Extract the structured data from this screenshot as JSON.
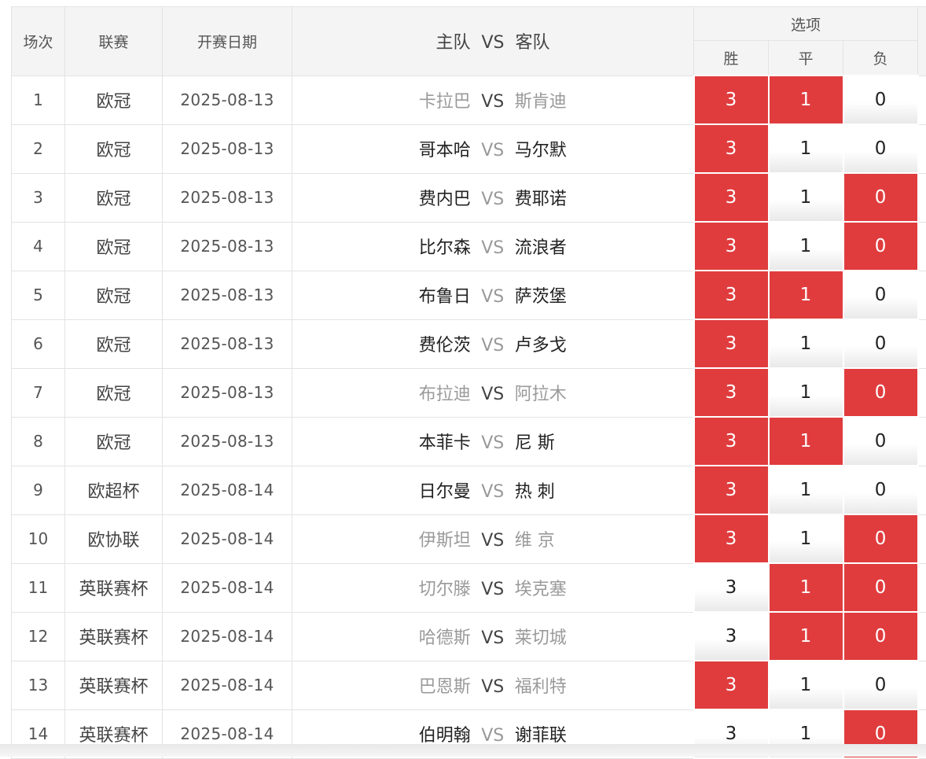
{
  "header": {
    "col_no": "场次",
    "col_league": "联赛",
    "col_date": "开赛日期",
    "col_home": "主队",
    "col_vs": "VS",
    "col_away": "客队",
    "col_options": "选项",
    "opt_win": "胜",
    "opt_draw": "平",
    "opt_lose": "负"
  },
  "colors": {
    "selected": "#e03c3e",
    "header_bg": "#f4f4f4"
  },
  "rows": [
    {
      "no": "1",
      "league": "欧冠",
      "date": "2025-08-13",
      "home": "卡拉巴",
      "vs": "VS",
      "away": "斯肯迪",
      "win": "3",
      "draw": "1",
      "lose": "0",
      "win_sel": true,
      "draw_sel": true,
      "lose_sel": false,
      "dim": true
    },
    {
      "no": "2",
      "league": "欧冠",
      "date": "2025-08-13",
      "home": "哥本哈",
      "vs": "VS",
      "away": "马尔默",
      "win": "3",
      "draw": "1",
      "lose": "0",
      "win_sel": true,
      "draw_sel": false,
      "lose_sel": false,
      "dim": false
    },
    {
      "no": "3",
      "league": "欧冠",
      "date": "2025-08-13",
      "home": "费内巴",
      "vs": "VS",
      "away": "费耶诺",
      "win": "3",
      "draw": "1",
      "lose": "0",
      "win_sel": true,
      "draw_sel": false,
      "lose_sel": true,
      "dim": false
    },
    {
      "no": "4",
      "league": "欧冠",
      "date": "2025-08-13",
      "home": "比尔森",
      "vs": "VS",
      "away": "流浪者",
      "win": "3",
      "draw": "1",
      "lose": "0",
      "win_sel": true,
      "draw_sel": false,
      "lose_sel": true,
      "dim": false
    },
    {
      "no": "5",
      "league": "欧冠",
      "date": "2025-08-13",
      "home": "布鲁日",
      "vs": "VS",
      "away": "萨茨堡",
      "win": "3",
      "draw": "1",
      "lose": "0",
      "win_sel": true,
      "draw_sel": true,
      "lose_sel": false,
      "dim": false
    },
    {
      "no": "6",
      "league": "欧冠",
      "date": "2025-08-13",
      "home": "费伦茨",
      "vs": "VS",
      "away": "卢多戈",
      "win": "3",
      "draw": "1",
      "lose": "0",
      "win_sel": true,
      "draw_sel": false,
      "lose_sel": false,
      "dim": false
    },
    {
      "no": "7",
      "league": "欧冠",
      "date": "2025-08-13",
      "home": "布拉迪",
      "vs": "VS",
      "away": "阿拉木",
      "win": "3",
      "draw": "1",
      "lose": "0",
      "win_sel": true,
      "draw_sel": false,
      "lose_sel": true,
      "dim": true
    },
    {
      "no": "8",
      "league": "欧冠",
      "date": "2025-08-13",
      "home": "本菲卡",
      "vs": "VS",
      "away": "尼 斯",
      "win": "3",
      "draw": "1",
      "lose": "0",
      "win_sel": true,
      "draw_sel": true,
      "lose_sel": false,
      "dim": false
    },
    {
      "no": "9",
      "league": "欧超杯",
      "date": "2025-08-14",
      "home": "日尔曼",
      "vs": "VS",
      "away": "热 刺",
      "win": "3",
      "draw": "1",
      "lose": "0",
      "win_sel": true,
      "draw_sel": false,
      "lose_sel": false,
      "dim": false
    },
    {
      "no": "10",
      "league": "欧协联",
      "date": "2025-08-14",
      "home": "伊斯坦",
      "vs": "VS",
      "away": "维 京",
      "win": "3",
      "draw": "1",
      "lose": "0",
      "win_sel": true,
      "draw_sel": false,
      "lose_sel": true,
      "dim": true
    },
    {
      "no": "11",
      "league": "英联赛杯",
      "date": "2025-08-14",
      "home": "切尔滕",
      "vs": "VS",
      "away": "埃克塞",
      "win": "3",
      "draw": "1",
      "lose": "0",
      "win_sel": false,
      "draw_sel": true,
      "lose_sel": true,
      "dim": true
    },
    {
      "no": "12",
      "league": "英联赛杯",
      "date": "2025-08-14",
      "home": "哈德斯",
      "vs": "VS",
      "away": "莱切城",
      "win": "3",
      "draw": "1",
      "lose": "0",
      "win_sel": false,
      "draw_sel": true,
      "lose_sel": true,
      "dim": true
    },
    {
      "no": "13",
      "league": "英联赛杯",
      "date": "2025-08-14",
      "home": "巴恩斯",
      "vs": "VS",
      "away": "福利特",
      "win": "3",
      "draw": "1",
      "lose": "0",
      "win_sel": true,
      "draw_sel": false,
      "lose_sel": false,
      "dim": true
    },
    {
      "no": "14",
      "league": "英联赛杯",
      "date": "2025-08-14",
      "home": "伯明翰",
      "vs": "VS",
      "away": "谢菲联",
      "win": "3",
      "draw": "1",
      "lose": "0",
      "win_sel": false,
      "draw_sel": false,
      "lose_sel": true,
      "dim": false
    }
  ]
}
